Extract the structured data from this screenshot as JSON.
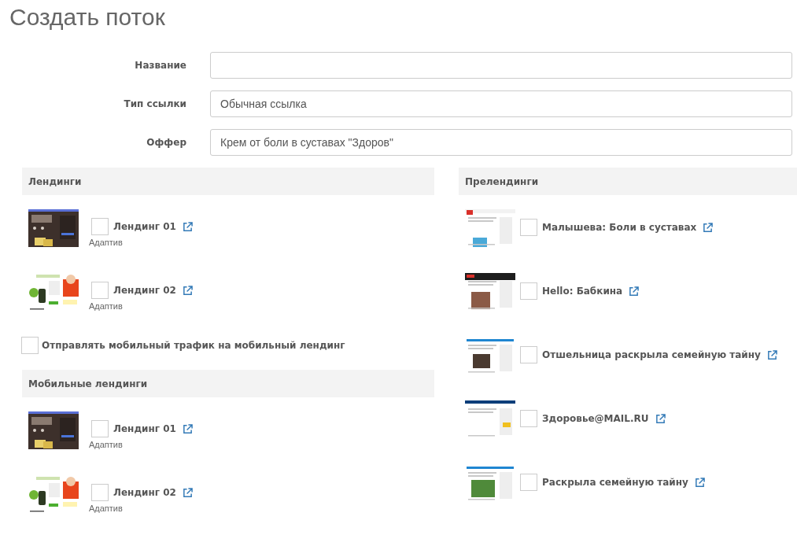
{
  "title": "Создать поток",
  "form": [
    {
      "label": "Название"
    },
    {
      "label": "Тип ссылки",
      "value": "Обычная ссылка"
    },
    {
      "label": "Оффер",
      "value": "Крем от боли в суставах \"Здоров\""
    }
  ],
  "landings": {
    "title": "Лендинги",
    "items": [
      {
        "name": "Лендинг 01",
        "checked": false,
        "note": "Адаптив"
      },
      {
        "name": "Лендинг 02",
        "checked": false,
        "note": "Адаптив"
      }
    ]
  },
  "mobile_toggle": {
    "label": "Отправлять мобильный трафик на мобильный лендинг",
    "checked": false
  },
  "mobile_landings": {
    "title": "Мобильные лендинги",
    "items": [
      {
        "name": "Лендинг 01",
        "checked": false,
        "note": "Адаптив"
      },
      {
        "name": "Лендинг 02",
        "checked": false,
        "note": "Адаптив"
      }
    ]
  },
  "prelandings": {
    "title": "Прелендинги",
    "items": [
      {
        "name": "Малышева: Боли в суставах",
        "checked": false
      },
      {
        "name": "Hello: Бабкина",
        "checked": false
      },
      {
        "name": "Отшельница раскрыла семейную тайну",
        "checked": false
      },
      {
        "name": "Здоровье@MAIL.RU",
        "checked": false
      },
      {
        "name": "Раскрыла семейную тайну",
        "checked": false
      }
    ]
  }
}
